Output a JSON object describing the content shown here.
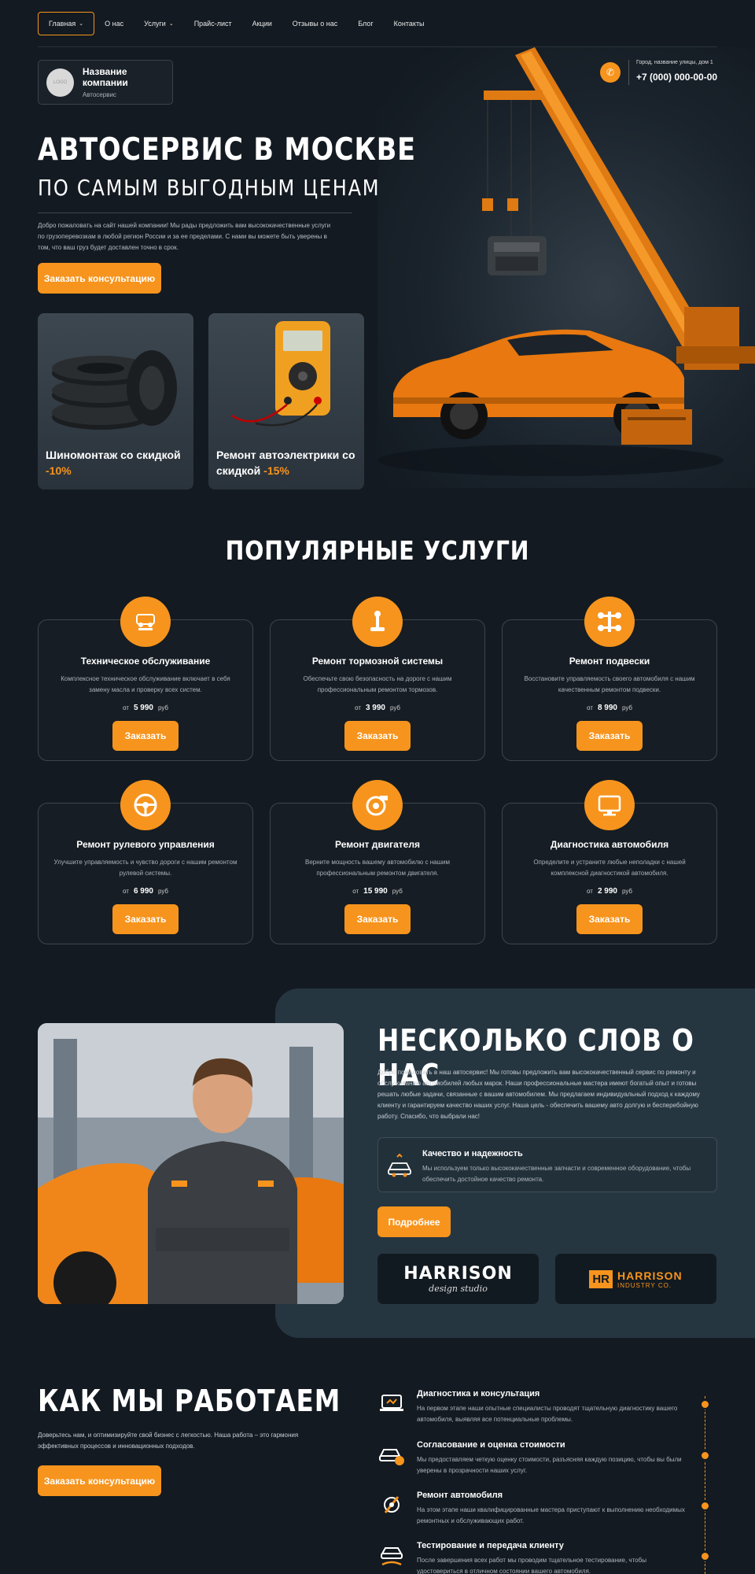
{
  "nav": {
    "items": [
      {
        "label": "Главная",
        "dropdown": true
      },
      {
        "label": "О нас",
        "dropdown": false
      },
      {
        "label": "Услуги",
        "dropdown": true
      },
      {
        "label": "Прайс-лист",
        "dropdown": false
      },
      {
        "label": "Акции",
        "dropdown": false
      },
      {
        "label": "Отзывы о нас",
        "dropdown": false
      },
      {
        "label": "Блог",
        "dropdown": false
      },
      {
        "label": "Контакты",
        "dropdown": false
      }
    ]
  },
  "logo": {
    "placeholder": "LOGO",
    "name": "Название компании",
    "tagline": "Автосервис"
  },
  "contact": {
    "address": "Город, название улицы, дом 1",
    "phone": "+7 (000) 000-00-00"
  },
  "hero": {
    "title": "АВТОСЕРВИС В МОСКВЕ",
    "subtitle": "ПО САМЫМ ВЫГОДНЫМ ЦЕНАМ",
    "description": "Добро пожаловать на сайт нашей компании! Мы рады предложить вам высококачественные услуги по грузоперевозкам в любой регион России и за ее пределами. С нами вы можете быть уверены в том, что ваш груз будет доставлен точно в срок.",
    "cta": "Заказать консультацию"
  },
  "promos": [
    {
      "line1": "Шиномонтаж со скидкой",
      "discount": "-10%"
    },
    {
      "line1": "Ремонт автоэлектрики со",
      "line2": "скидкой",
      "discount": "-15%"
    }
  ],
  "services": {
    "title": "ПОПУЛЯРНЫЕ УСЛУГИ",
    "price_prefix": "от",
    "currency": "руб",
    "order_label": "Заказать",
    "items": [
      {
        "name": "Техническое обслуживание",
        "desc": "Комплексное техническое обслуживание включает в себя замену масла и проверку всех систем.",
        "price": "5 990",
        "icon": "car-service-icon"
      },
      {
        "name": "Ремонт тормозной системы",
        "desc": "Обеспечьте свою безопасность на дороге с нашим профессиональным ремонтом тормозов.",
        "price": "3 990",
        "icon": "gear-shift-icon"
      },
      {
        "name": "Ремонт подвески",
        "desc": "Восстановите управляемость своего автомобиля с нашим качественным ремонтом подвески.",
        "price": "8 990",
        "icon": "suspension-icon"
      },
      {
        "name": "Ремонт рулевого управления",
        "desc": "Улучшите управляемость и чувство дороги с нашим ремонтом рулевой системы.",
        "price": "6 990",
        "icon": "steering-wheel-icon"
      },
      {
        "name": "Ремонт двигателя",
        "desc": "Верните мощность вашему автомобилю с нашим профессиональным ремонтом двигателя.",
        "price": "15 990",
        "icon": "turbo-icon"
      },
      {
        "name": "Диагностика автомобиля",
        "desc": "Определите и устраните любые неполадки с нашей комплексной диагностикой автомобиля.",
        "price": "2 990",
        "icon": "diagnostic-monitor-icon"
      }
    ]
  },
  "about": {
    "title": "НЕСКОЛЬКО СЛОВ О НАС",
    "description": "Добро пожаловать в наш автосервис! Мы готовы предложить вам высококачественный сервис по ремонту и обслуживанию автомобилей любых марок. Наши профессиональные мастера имеют богатый опыт и готовы решать любые задачи, связанные с вашим автомобилем. Мы предлагаем индивидуальный подход к каждому клиенту и гарантируем качество наших услуг. Наша цель - обеспечить вашему авто долгую и бесперебойную работу. Спасибо, что выбрали нас!",
    "quality_title": "Качество и надежность",
    "quality_desc": "Мы используем только высококачественные запчасти и современное оборудование, чтобы обеспечить достойное качество ремонта.",
    "more": "Подробнее",
    "partners": [
      {
        "line1": "HARRISON",
        "line2": "design studio"
      },
      {
        "mark": "HR",
        "line1": "HARRISON",
        "line2": "INDUSTRY CO."
      }
    ]
  },
  "how": {
    "title": "КАК МЫ РАБОТАЕМ",
    "description": "Доверьтесь нам, и оптимизируйте свой бизнес с легкостью. Наша работа – это гармония эффективных процессов и инновационных подходов.",
    "cta": "Заказать консультацию",
    "steps": [
      {
        "title": "Диагностика и консультация",
        "desc": "На первом этапе наши опытные специалисты проводят тщательную диагностику вашего автомобиля, выявляя все потенциальные проблемы."
      },
      {
        "title": "Согласование и оценка стоимости",
        "desc": "Мы предоставляем четкую оценку стоимости, разъясняя каждую позицию, чтобы вы были уверены в прозрачности наших услуг."
      },
      {
        "title": "Ремонт автомобиля",
        "desc": "На этом этапе наши квалифицированные мастера приступают к выполнению необходимых ремонтных и обслуживающих работ."
      },
      {
        "title": "Тестирование и передача клиенту",
        "desc": "После завершения всех работ мы проводим тщательное тестирование, чтобы удостовериться в отличном состоянии вашего автомобиля."
      }
    ]
  },
  "colors": {
    "accent": "#f7941d",
    "background": "#131a21",
    "panel": "#263641"
  }
}
